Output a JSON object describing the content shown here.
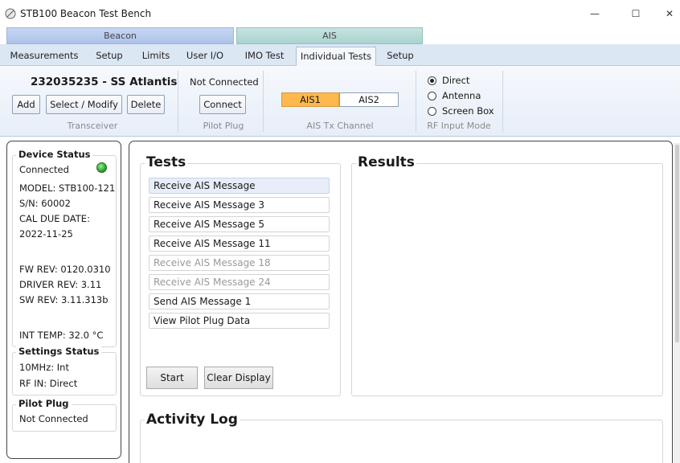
{
  "window": {
    "title": "STB100 Beacon Test Bench",
    "controls": {
      "minimize": "—",
      "maximize": "☐",
      "close": "✕"
    }
  },
  "groups": {
    "beacon": "Beacon",
    "ais": "AIS"
  },
  "tabs": [
    {
      "label": "Measurements"
    },
    {
      "label": "Setup"
    },
    {
      "label": "Limits"
    },
    {
      "label": "User I/O"
    },
    {
      "label": "IMO Test"
    },
    {
      "label": "Individual Tests",
      "active": true
    },
    {
      "label": "Setup"
    }
  ],
  "ribbon": {
    "transceiver": {
      "name": "232035235 - SS Atlantis",
      "add_label": "Add",
      "select_label": "Select / Modify",
      "delete_label": "Delete",
      "group_label": "Transceiver"
    },
    "pilot_plug": {
      "status": "Not Connected",
      "connect_label": "Connect",
      "group_label": "Pilot Plug"
    },
    "ais_channel": {
      "options": [
        "AIS1",
        "AIS2"
      ],
      "selected": "AIS1",
      "group_label": "AIS Tx Channel"
    },
    "rf_input": {
      "options": [
        "Direct",
        "Antenna",
        "Screen Box"
      ],
      "selected": "Direct",
      "group_label": "RF Input Mode"
    }
  },
  "device_status": {
    "title": "Device Status",
    "connection": "Connected",
    "model": "MODEL: STB100-121",
    "serial": "S/N: 60002",
    "cal_due_label": "CAL DUE DATE:",
    "cal_due_date": "2022-11-25",
    "fw_rev": "FW REV: 0120.0310",
    "driver_rev": "DRIVER REV: 3.11",
    "sw_rev": "SW REV: 3.11.313b",
    "int_temp": "INT TEMP: 32.0 °C"
  },
  "settings_status": {
    "title": "Settings Status",
    "clock": "10MHz: Int",
    "rf_in": "RF IN: Direct"
  },
  "pilot_plug_status": {
    "title": "Pilot Plug",
    "status": "Not Connected"
  },
  "tests": {
    "title": "Tests",
    "items": [
      {
        "label": "Receive AIS Message",
        "selected": true
      },
      {
        "label": "Receive AIS Message 3"
      },
      {
        "label": "Receive AIS Message 5"
      },
      {
        "label": "Receive AIS Message 11"
      },
      {
        "label": "Receive AIS Message 18",
        "disabled": true
      },
      {
        "label": "Receive AIS Message 24",
        "disabled": true
      },
      {
        "label": "Send AIS Message 1"
      },
      {
        "label": "View Pilot Plug Data"
      }
    ],
    "start_label": "Start",
    "clear_label": "Clear Display"
  },
  "results": {
    "title": "Results"
  },
  "activity_log": {
    "title": "Activity Log"
  },
  "colors": {
    "selected_channel": "#ffb84d",
    "status_led": "#1c9a1c"
  }
}
